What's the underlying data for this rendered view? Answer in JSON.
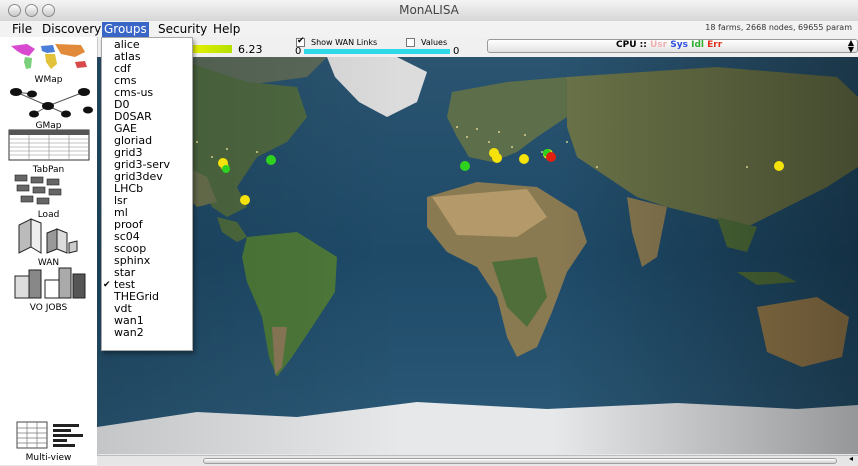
{
  "window": {
    "title": "MonALISA"
  },
  "menubar": {
    "items": [
      {
        "label": "File",
        "underline": "F"
      },
      {
        "label": "Discovery",
        "underline": "D"
      },
      {
        "label": "Groups",
        "underline": "G"
      },
      {
        "label": "Security",
        "underline": "S"
      },
      {
        "label": "Help",
        "underline": "H"
      }
    ],
    "active": "Groups",
    "status": "18 farms, 2668 nodes, 69655 param"
  },
  "toolbar": {
    "metric_value": "6.23",
    "show_wan_label": "Show WAN Links",
    "show_wan_checked": true,
    "values_label": "Values",
    "values_checked": false,
    "scale_min": "0",
    "scale_max": "0",
    "cpu_selector": {
      "label": "CPU ::",
      "parts": [
        {
          "text": "Usr",
          "color": "#f0b0b0"
        },
        {
          "text": "Sys",
          "color": "#3050e0"
        },
        {
          "text": "Idl",
          "color": "#2fae2f"
        },
        {
          "text": "Err",
          "color": "#e03020"
        }
      ]
    }
  },
  "sidebar": {
    "items": [
      {
        "label": "WMap",
        "icon": "world-map-icon"
      },
      {
        "label": "GMap",
        "icon": "graph-map-icon"
      },
      {
        "label": "TabPan",
        "icon": "table-panel-icon"
      },
      {
        "label": "Load",
        "icon": "load-icon"
      },
      {
        "label": "WAN",
        "icon": "wan-icon"
      },
      {
        "label": "VO JOBS",
        "icon": "vo-jobs-icon"
      },
      {
        "label": "Multi-view",
        "icon": "multi-view-icon"
      }
    ]
  },
  "groups_menu": {
    "items": [
      {
        "label": "alice",
        "checked": false
      },
      {
        "label": "atlas",
        "checked": false
      },
      {
        "label": "cdf",
        "checked": false
      },
      {
        "label": "cms",
        "checked": false
      },
      {
        "label": "cms-us",
        "checked": false
      },
      {
        "label": "D0",
        "checked": false
      },
      {
        "label": "D0SAR",
        "checked": false
      },
      {
        "label": "GAE",
        "checked": false
      },
      {
        "label": "gloriad",
        "checked": false
      },
      {
        "label": "grid3",
        "checked": false
      },
      {
        "label": "grid3-serv",
        "checked": false
      },
      {
        "label": "grid3dev",
        "checked": false
      },
      {
        "label": "LHCb",
        "checked": false
      },
      {
        "label": "lsr",
        "checked": false
      },
      {
        "label": "ml",
        "checked": false
      },
      {
        "label": "proof",
        "checked": false
      },
      {
        "label": "sc04",
        "checked": false
      },
      {
        "label": "scoop",
        "checked": false
      },
      {
        "label": "sphinx",
        "checked": false
      },
      {
        "label": "star",
        "checked": false
      },
      {
        "label": "test",
        "checked": true
      },
      {
        "label": "THEGrid",
        "checked": false
      },
      {
        "label": "vdt",
        "checked": false
      },
      {
        "label": "wan1",
        "checked": false
      },
      {
        "label": "wan2",
        "checked": false
      }
    ]
  },
  "map": {
    "farms": [
      {
        "status": "yellow",
        "color": "#f4e20a"
      },
      {
        "status": "yellow",
        "color": "#f4e20a"
      },
      {
        "status": "green",
        "color": "#2fd21f"
      },
      {
        "status": "green",
        "color": "#2fd21f"
      },
      {
        "status": "yellow",
        "color": "#f4e20a"
      },
      {
        "status": "green",
        "color": "#2fd21f"
      },
      {
        "status": "yellow",
        "color": "#f4e20a"
      },
      {
        "status": "yellow",
        "color": "#f4e20a"
      },
      {
        "status": "yellow",
        "color": "#f4e20a"
      },
      {
        "status": "yellow",
        "color": "#f4e20a"
      },
      {
        "status": "green",
        "color": "#2fd21f"
      },
      {
        "status": "red",
        "color": "#e22010"
      },
      {
        "status": "yellow",
        "color": "#f4e20a"
      }
    ]
  }
}
